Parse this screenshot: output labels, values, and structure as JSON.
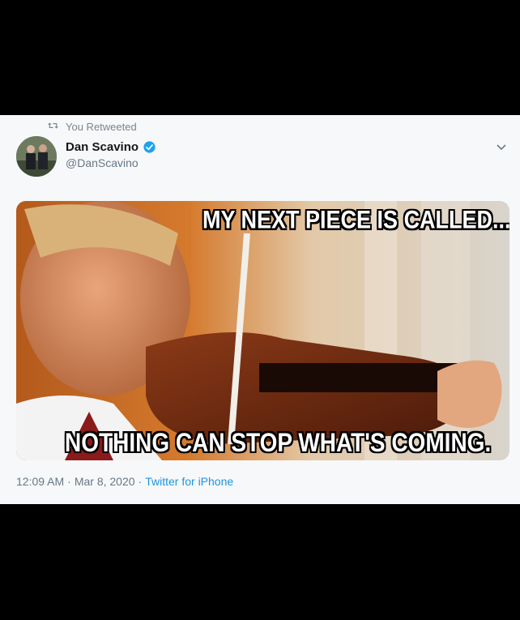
{
  "tweet": {
    "retweet_label": "You Retweeted",
    "author": {
      "display_name": "Dan Scavino",
      "handle": "@DanScavino",
      "verified": true
    },
    "media": {
      "caption_top": "MY NEXT PIECE IS CALLED...",
      "caption_bottom": "NOTHING CAN STOP WHAT'S COMING."
    },
    "time": "12:09 AM",
    "separator_1": "·",
    "date": "Mar 8, 2020",
    "separator_2": "·",
    "source": "Twitter for iPhone"
  },
  "icons": {
    "retweet": "retweet-icon",
    "verified": "verified-badge-icon",
    "menu": "chevron-down-icon"
  },
  "colors": {
    "background": "#000000",
    "card": "#f7f8f9",
    "link": "#1b95e0",
    "verified": "#1da1f2",
    "muted": "#657786"
  }
}
